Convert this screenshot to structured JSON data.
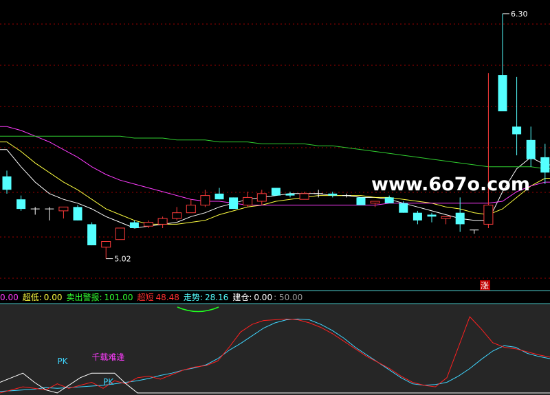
{
  "colors": {
    "background": "#000000",
    "up": "#ff3b3b",
    "down": "#54ffff",
    "flat": "#ffffff",
    "grid": "#a00000",
    "ma_white": "#ffffff",
    "ma_yellow": "#ffff40",
    "ma_magenta": "#ff3cff",
    "ma_green": "#30d030",
    "osc_cyan": "#3fd6ff",
    "osc_red": "#ff2020",
    "osc_white": "#ffffff",
    "osc_green": "#20ff20",
    "panel_bg": "#2a2a2a",
    "separator": "#4fd0d0"
  },
  "watermark": "www.6o7o.com",
  "price_labels": {
    "high": "6.30",
    "low": "5.02"
  },
  "zhang_badge": "涨",
  "indicator_bar": [
    {
      "label": "0.00",
      "color": "#ff3cff"
    },
    {
      "label": "超低:",
      "color": "#ffff40"
    },
    {
      "label": "0.00",
      "color": "#ffff40"
    },
    {
      "label": "卖出警报:",
      "color": "#30ff30"
    },
    {
      "label": "101.00",
      "color": "#30ff30"
    },
    {
      "label": "超短",
      "color": "#ff3030"
    },
    {
      "label": "48.48",
      "color": "#ff3030"
    },
    {
      "label": "走势:",
      "color": "#54ffff"
    },
    {
      "label": "28.16",
      "color": "#54ffff"
    },
    {
      "label": "建仓:",
      "color": "#ffffff"
    },
    {
      "label": "0.00",
      "color": "#ffffff"
    },
    {
      "label": ": 50.00",
      "color": "#9a9a9a"
    }
  ],
  "signal_labels": [
    {
      "text": "PK",
      "color": "#3fd6ff",
      "ts": 5
    },
    {
      "text": "PK",
      "color": "#3fd6ff",
      "ts": 9
    },
    {
      "text": "千载难逢",
      "color": "#ff3cff",
      "ts": 8
    }
  ],
  "chart_data": {
    "type": "candlestick",
    "candles": [
      {
        "o": 5.45,
        "h": 5.48,
        "l": 5.36,
        "c": 5.38
      },
      {
        "o": 5.33,
        "h": 5.35,
        "l": 5.27,
        "c": 5.28
      },
      {
        "o": 5.28,
        "h": 5.29,
        "l": 5.25,
        "c": 5.28
      },
      {
        "o": 5.28,
        "h": 5.29,
        "l": 5.22,
        "c": 5.28
      },
      {
        "o": 5.27,
        "h": 5.29,
        "l": 5.23,
        "c": 5.29
      },
      {
        "o": 5.29,
        "h": 5.3,
        "l": 5.22,
        "c": 5.22
      },
      {
        "o": 5.2,
        "h": 5.21,
        "l": 5.09,
        "c": 5.09
      },
      {
        "o": 5.08,
        "h": 5.11,
        "l": 5.02,
        "c": 5.11
      },
      {
        "o": 5.12,
        "h": 5.18,
        "l": 5.12,
        "c": 5.18
      },
      {
        "o": 5.21,
        "h": 5.22,
        "l": 5.18,
        "c": 5.18
      },
      {
        "o": 5.19,
        "h": 5.22,
        "l": 5.18,
        "c": 5.21
      },
      {
        "o": 5.2,
        "h": 5.24,
        "l": 5.18,
        "c": 5.23
      },
      {
        "o": 5.23,
        "h": 5.29,
        "l": 5.22,
        "c": 5.26
      },
      {
        "o": 5.26,
        "h": 5.33,
        "l": 5.26,
        "c": 5.3
      },
      {
        "o": 5.3,
        "h": 5.38,
        "l": 5.29,
        "c": 5.35
      },
      {
        "o": 5.36,
        "h": 5.39,
        "l": 5.33,
        "c": 5.33
      },
      {
        "o": 5.34,
        "h": 5.34,
        "l": 5.28,
        "c": 5.28
      },
      {
        "o": 5.3,
        "h": 5.37,
        "l": 5.29,
        "c": 5.34
      },
      {
        "o": 5.32,
        "h": 5.38,
        "l": 5.3,
        "c": 5.36
      },
      {
        "o": 5.39,
        "h": 5.39,
        "l": 5.35,
        "c": 5.35
      },
      {
        "o": 5.36,
        "h": 5.37,
        "l": 5.34,
        "c": 5.35
      },
      {
        "o": 5.33,
        "h": 5.37,
        "l": 5.33,
        "c": 5.36
      },
      {
        "o": 5.36,
        "h": 5.38,
        "l": 5.34,
        "c": 5.36
      },
      {
        "o": 5.36,
        "h": 5.37,
        "l": 5.34,
        "c": 5.35
      },
      {
        "o": 5.35,
        "h": 5.36,
        "l": 5.34,
        "c": 5.35
      },
      {
        "o": 5.34,
        "h": 5.34,
        "l": 5.3,
        "c": 5.3
      },
      {
        "o": 5.31,
        "h": 5.32,
        "l": 5.29,
        "c": 5.32
      },
      {
        "o": 5.34,
        "h": 5.35,
        "l": 5.31,
        "c": 5.31
      },
      {
        "o": 5.31,
        "h": 5.32,
        "l": 5.26,
        "c": 5.26
      },
      {
        "o": 5.26,
        "h": 5.27,
        "l": 5.2,
        "c": 5.22
      },
      {
        "o": 5.25,
        "h": 5.26,
        "l": 5.21,
        "c": 5.24
      },
      {
        "o": 5.23,
        "h": 5.24,
        "l": 5.2,
        "c": 5.24
      },
      {
        "o": 5.26,
        "h": 5.34,
        "l": 5.16,
        "c": 5.2
      },
      {
        "o": 5.17,
        "h": 5.17,
        "l": 5.15,
        "c": 5.17
      },
      {
        "o": 5.2,
        "h": 5.99,
        "l": 5.18,
        "c": 5.3
      },
      {
        "o": 5.98,
        "h": 6.3,
        "l": 5.79,
        "c": 5.79
      },
      {
        "o": 5.71,
        "h": 5.97,
        "l": 5.56,
        "c": 5.67
      },
      {
        "o": 5.64,
        "h": 5.71,
        "l": 5.5,
        "c": 5.54
      },
      {
        "o": 5.55,
        "h": 5.62,
        "l": 5.41,
        "c": 5.47
      }
    ],
    "moving_averages": [
      {
        "name": "MA5",
        "color": "#ffffff",
        "values": [
          5.59,
          5.5,
          5.42,
          5.36,
          5.33,
          5.31,
          5.28,
          5.24,
          5.21,
          5.18,
          5.19,
          5.2,
          5.21,
          5.24,
          5.26,
          5.29,
          5.31,
          5.33,
          5.34,
          5.35,
          5.36,
          5.36,
          5.36,
          5.35,
          5.35,
          5.34,
          5.34,
          5.33,
          5.31,
          5.29,
          5.27,
          5.25,
          5.23,
          5.22,
          5.22,
          5.37,
          5.49,
          5.55,
          5.51
        ]
      },
      {
        "name": "MA10",
        "color": "#ffff40",
        "values": [
          5.63,
          5.58,
          5.52,
          5.47,
          5.42,
          5.38,
          5.33,
          5.28,
          5.25,
          5.22,
          5.2,
          5.2,
          5.2,
          5.21,
          5.22,
          5.25,
          5.27,
          5.29,
          5.3,
          5.32,
          5.33,
          5.34,
          5.35,
          5.35,
          5.35,
          5.35,
          5.34,
          5.34,
          5.33,
          5.32,
          5.31,
          5.29,
          5.28,
          5.26,
          5.25,
          5.28,
          5.34,
          5.4,
          5.44
        ]
      },
      {
        "name": "MA20",
        "color": "#ff3cff",
        "values": [
          5.71,
          5.69,
          5.66,
          5.63,
          5.59,
          5.55,
          5.5,
          5.46,
          5.43,
          5.41,
          5.39,
          5.37,
          5.35,
          5.33,
          5.32,
          5.32,
          5.31,
          5.3,
          5.3,
          5.3,
          5.3,
          5.3,
          5.3,
          5.3,
          5.3,
          5.3,
          5.3,
          5.31,
          5.31,
          5.31,
          5.31,
          5.31,
          5.31,
          5.31,
          5.31,
          5.32,
          5.37,
          5.4,
          5.42
        ]
      },
      {
        "name": "MA60",
        "color": "#30d030",
        "values": [
          5.66,
          5.66,
          5.66,
          5.66,
          5.66,
          5.66,
          5.66,
          5.66,
          5.66,
          5.65,
          5.65,
          5.65,
          5.64,
          5.64,
          5.64,
          5.63,
          5.63,
          5.63,
          5.62,
          5.62,
          5.62,
          5.62,
          5.61,
          5.61,
          5.6,
          5.59,
          5.58,
          5.57,
          5.56,
          5.55,
          5.54,
          5.53,
          5.52,
          5.51,
          5.5,
          5.5,
          5.5,
          5.5,
          5.49
        ]
      }
    ],
    "ylim": [
      4.9,
      6.35
    ],
    "oscillator": {
      "ylim": [
        0,
        110
      ],
      "series": [
        {
          "key": "cyan",
          "color": "#3fd6ff",
          "values": [
            2,
            3,
            4,
            5,
            7,
            6,
            7,
            8,
            9,
            10,
            12,
            14,
            16,
            19,
            23,
            26,
            30,
            33,
            37,
            45,
            56,
            65,
            75,
            85,
            92,
            96,
            97,
            96,
            90,
            82,
            72,
            60,
            50,
            40,
            30,
            20,
            12,
            10,
            11,
            14,
            22,
            32,
            44,
            55,
            62,
            60,
            52,
            48,
            45
          ]
        },
        {
          "key": "red",
          "color": "#ff2020",
          "values": [
            0,
            4,
            8,
            6,
            4,
            12,
            6,
            10,
            14,
            6,
            16,
            12,
            20,
            22,
            18,
            24,
            30,
            34,
            36,
            42,
            60,
            80,
            90,
            95,
            96,
            97,
            96,
            92,
            86,
            78,
            68,
            58,
            48,
            40,
            32,
            22,
            14,
            10,
            8,
            20,
            60,
            100,
            84,
            66,
            60,
            58,
            54,
            50,
            47
          ]
        },
        {
          "key": "white",
          "color": "#ffffff",
          "values": [
            14,
            20,
            26,
            14,
            4,
            0,
            10,
            20,
            26,
            26,
            26,
            12,
            0,
            0,
            0,
            0,
            0,
            0,
            0,
            0,
            0,
            0,
            0,
            0,
            0,
            0,
            0,
            0,
            0,
            0,
            0,
            0,
            0,
            0,
            0,
            0,
            0,
            0,
            0,
            0,
            0,
            0,
            0,
            0,
            0,
            0,
            0,
            0,
            0
          ]
        }
      ]
    }
  }
}
